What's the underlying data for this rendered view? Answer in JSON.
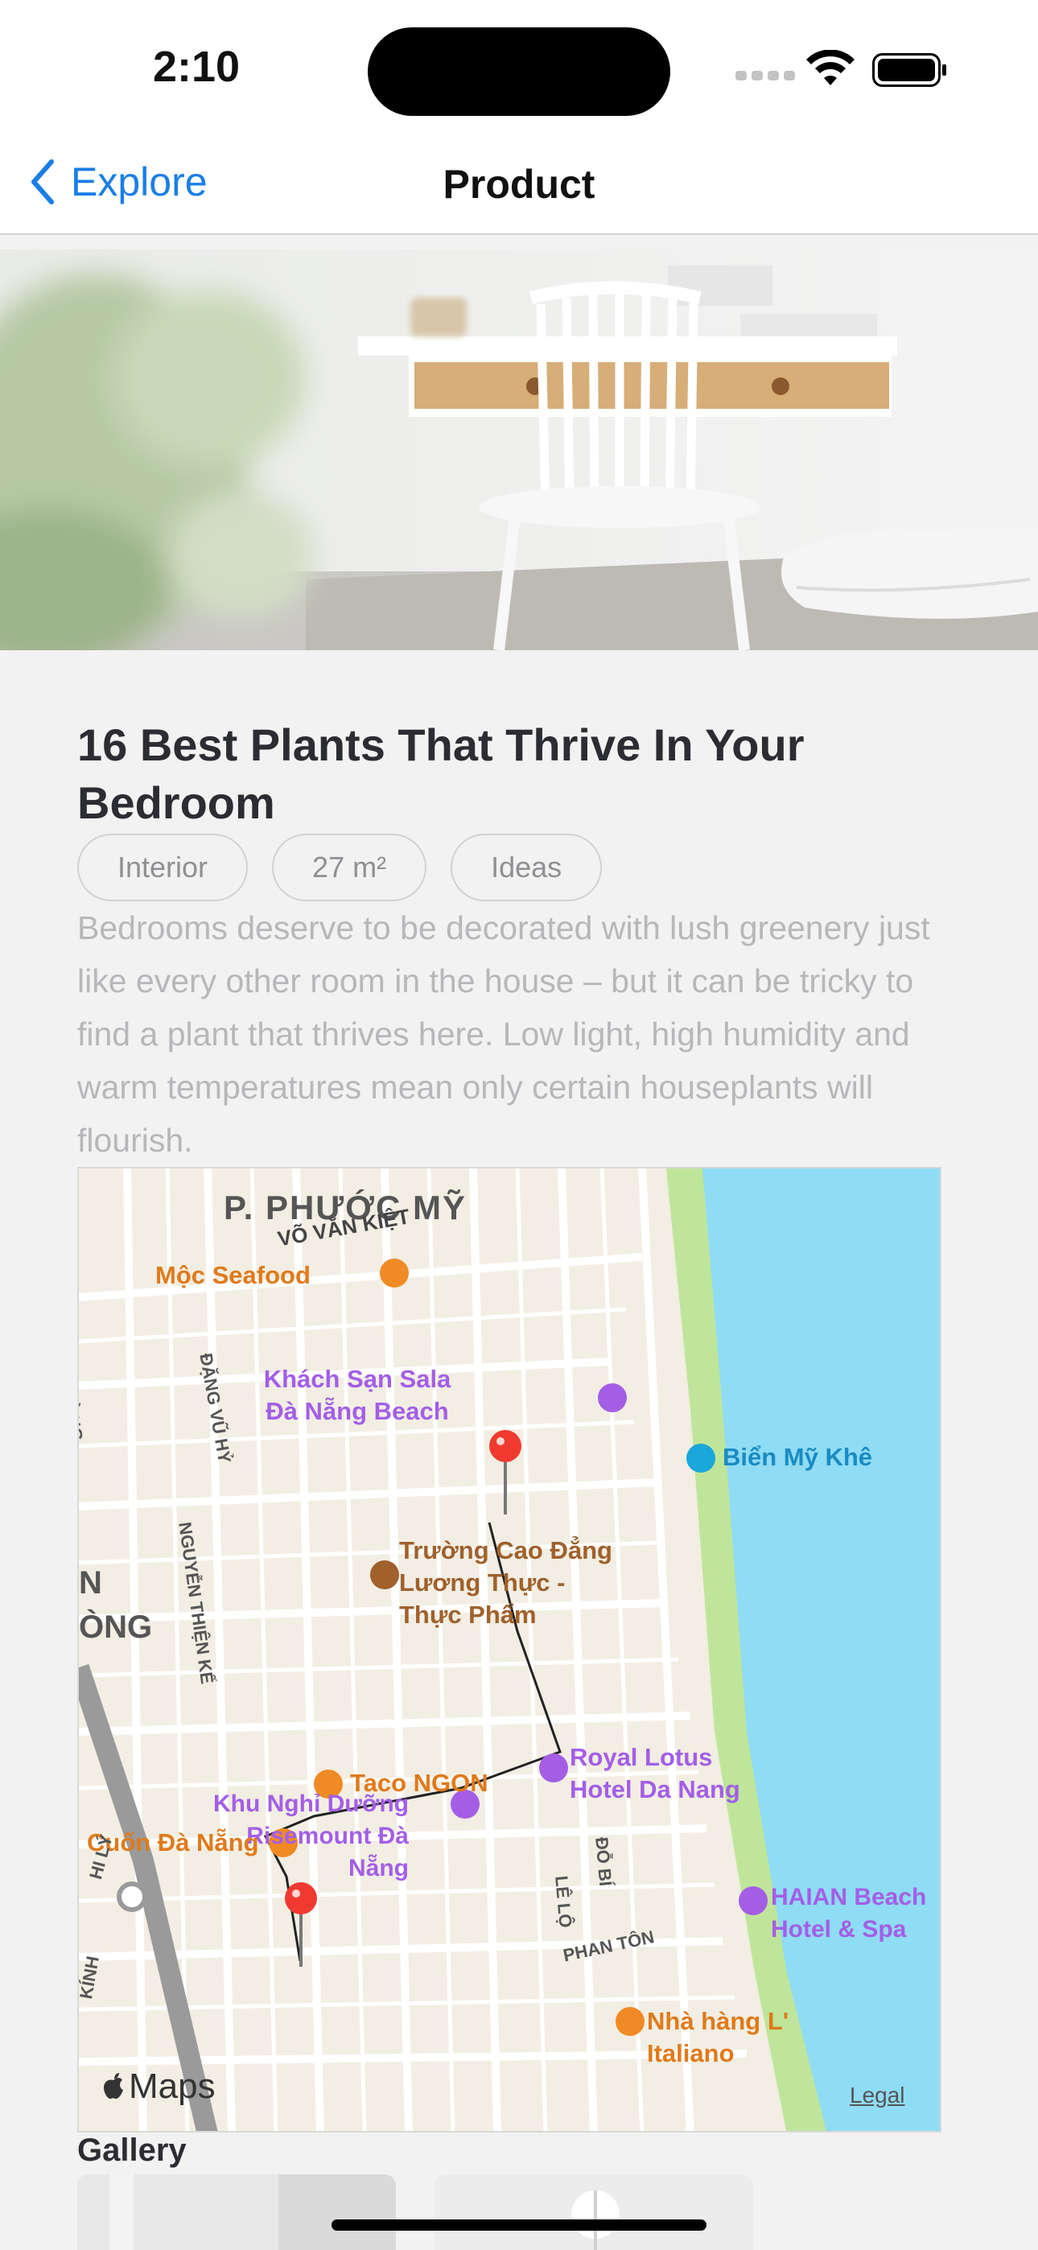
{
  "status_bar": {
    "time": "2:10"
  },
  "nav": {
    "back_label": "Explore",
    "title": "Product"
  },
  "article": {
    "title": "16 Best Plants That Thrive In Your Bedroom",
    "tags": [
      "Interior",
      "27 m²",
      "Ideas"
    ],
    "description": "Bedrooms deserve to be decorated with lush greenery just like every other room in the house – but it can be tricky to find a plant that thrives here. Low light, high humidity and warm temperatures mean only certain houseplants will flourish."
  },
  "map": {
    "district": "P. PHƯỚC MỸ",
    "streets": [
      "VÕ VĂN KIỆT",
      "ĐẶNG VŨ HỶ",
      "NGUYỄN THIỆN KẾ",
      "LÊ LỘ",
      "ĐỖ BÍ",
      "PHAN TÔN"
    ],
    "places": {
      "moc_seafood": "Mộc Seafood",
      "khach_san_sala": "Khách Sạn Sala Đà Nẵng Beach",
      "bien_my_khe": "Biển Mỹ Khê",
      "truong_cao_dang": "Trường Cao Đẳng Lương Thực - Thực Phẩm",
      "taco_ngon": "Taco NGON",
      "khu_nghi_duong": "Khu Nghỉ Dưỡng Risemount Đà Nẵng",
      "royal_lotus": "Royal Lotus Hotel Da Nang",
      "cuon_da_nang": "Cuốn Đà Nẵng",
      "haian_beach": "HAIAN Beach Hotel & Spa",
      "nha_hang_italiano": "Nhà hàng L' Italiano"
    },
    "edge_labels": [
      "N",
      "ÒNG",
      "ƯỜNG",
      "KÍNH",
      "HI LÝ"
    ],
    "logo_text": "Maps",
    "legal": "Legal",
    "colors": {
      "water": "#8fdcf5",
      "beach": "#bfe59a",
      "land": "#f2eee3",
      "route": "#222222",
      "pin": "#f03a30",
      "hotel": "#a45ee6",
      "food": "#f08a24",
      "school": "#a0612b"
    }
  },
  "gallery": {
    "title": "Gallery"
  }
}
